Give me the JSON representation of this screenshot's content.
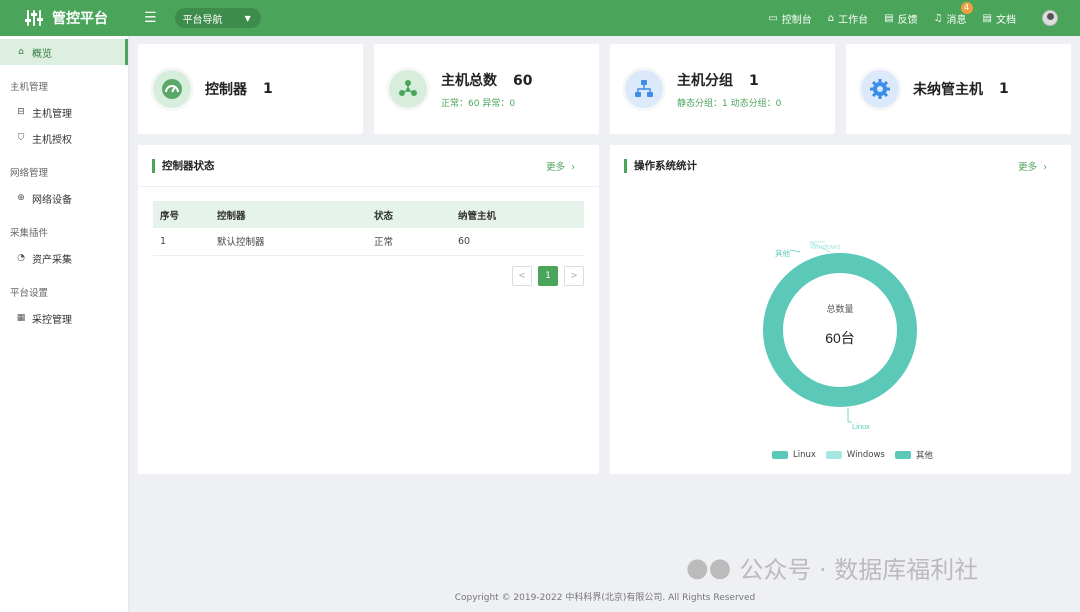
{
  "topbar": {
    "title": "管控平台",
    "nav_select": "平台导航",
    "items": [
      {
        "label": "控制台",
        "icon": "monitor-icon"
      },
      {
        "label": "工作台",
        "icon": "home-icon"
      },
      {
        "label": "反馈",
        "icon": "document-icon"
      },
      {
        "label": "消息",
        "icon": "bell-icon",
        "badge": "4"
      },
      {
        "label": "文档",
        "icon": "document-icon"
      }
    ]
  },
  "sidebar": {
    "active": "概览",
    "groups": [
      {
        "title": "主机管理",
        "items": [
          "主机管理",
          "主机授权"
        ]
      },
      {
        "title": "网络管理",
        "items": [
          "网络设备"
        ]
      },
      {
        "title": "采集插件",
        "items": [
          "资产采集"
        ]
      },
      {
        "title": "平台设置",
        "items": [
          "采控管理"
        ]
      }
    ]
  },
  "stats": [
    {
      "title": "控制器",
      "value": "1",
      "sub": ""
    },
    {
      "title": "主机总数",
      "value": "60",
      "sub": "正常：60   异常：0"
    },
    {
      "title": "主机分组",
      "value": "1",
      "sub": "静态分组：1   动态分组：0"
    },
    {
      "title": "未纳管主机",
      "value": "1",
      "sub": ""
    }
  ],
  "controller_panel": {
    "title": "控制器状态",
    "more": "更多",
    "columns": [
      "序号",
      "控制器",
      "状态",
      "纳管主机"
    ],
    "rows": [
      [
        "1",
        "默认控制器",
        "正常",
        "60"
      ]
    ],
    "pager": {
      "prev": "<",
      "page": "1",
      "next": ">"
    }
  },
  "os_panel": {
    "title": "操作系统统计",
    "more": "更多",
    "center_label": "总数量",
    "center_value": "60台"
  },
  "chart_data": {
    "type": "pie",
    "categories": [
      "Linux",
      "Windows",
      "其他"
    ],
    "values": [
      60,
      0,
      0
    ],
    "colors": [
      "#5cc8b8",
      "#a6e8e0",
      "#5cc8b8"
    ],
    "legend_position": "bottom"
  },
  "footer": "Copyright © 2019-2022 中科科界(北京)有限公司. All Rights Reserved",
  "watermark": "公众号 · 数据库福利社"
}
